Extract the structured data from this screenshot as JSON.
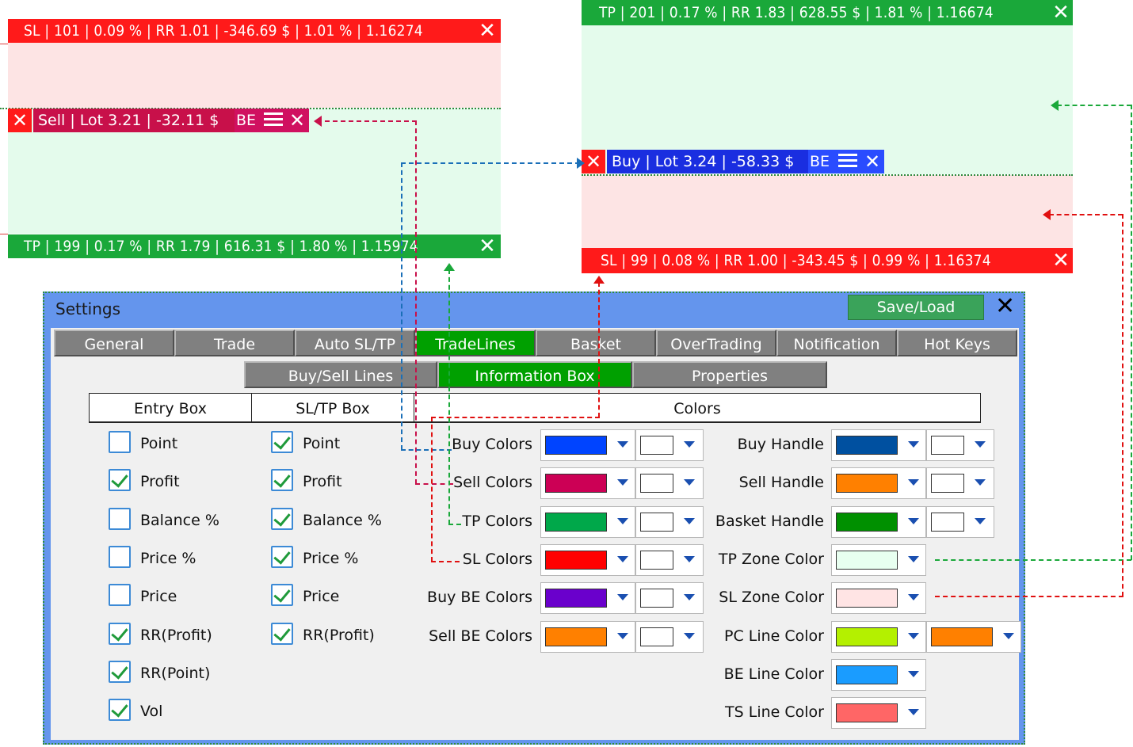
{
  "sell_box": {
    "sl_bar": "SL | 101 | 0.09 % | RR 1.01 | -346.69 $ | 1.01 % | 1.16274",
    "tp_bar": "TP | 199 | 0.17 % | RR 1.79 | 616.31 $ | 1.80 % | 1.15974",
    "label": "Sell | Lot 3.21 | -32.11 $",
    "be": "BE"
  },
  "buy_box": {
    "tp_bar": "TP | 201 | 0.17 % | RR 1.83 | 628.55 $ | 1.81 % | 1.16674",
    "sl_bar": "SL | 99 | 0.08 % | RR 1.00 | -343.45 $ | 0.99 % | 1.16374",
    "label": "Buy | Lot 3.24 | -58.33 $",
    "be": "BE"
  },
  "settings": {
    "title": "Settings",
    "save_load": "Save/Load",
    "close_glyph": "✕",
    "tabs": [
      "General",
      "Trade",
      "Auto SL/TP",
      "TradeLines",
      "Basket",
      "OverTrading",
      "Notification",
      "Hot Keys"
    ],
    "subtabs": [
      "Buy/Sell Lines",
      "Information Box",
      "Properties"
    ],
    "headers": {
      "entry": "Entry Box",
      "sltp": "SL/TP Box",
      "colors": "Colors"
    },
    "entry_box": [
      {
        "label": "Point",
        "checked": false
      },
      {
        "label": "Profit",
        "checked": true
      },
      {
        "label": "Balance %",
        "checked": false
      },
      {
        "label": "Price %",
        "checked": false
      },
      {
        "label": "Price",
        "checked": false
      },
      {
        "label": "RR(Profit)",
        "checked": true
      },
      {
        "label": "RR(Point)",
        "checked": true
      },
      {
        "label": "Vol",
        "checked": true
      }
    ],
    "sltp_box": [
      {
        "label": "Point",
        "checked": true
      },
      {
        "label": "Profit",
        "checked": true
      },
      {
        "label": "Balance %",
        "checked": true
      },
      {
        "label": "Price %",
        "checked": true
      },
      {
        "label": "Price",
        "checked": true
      },
      {
        "label": "RR(Profit)",
        "checked": true
      }
    ],
    "colors_left": [
      {
        "label": "Buy Colors",
        "c1": "#0044ff",
        "c2": "#ffffff"
      },
      {
        "label": "Sell Colors",
        "c1": "#cc0055",
        "c2": "#ffffff"
      },
      {
        "label": "TP Colors",
        "c1": "#00a84a",
        "c2": "#ffffff"
      },
      {
        "label": "SL Colors",
        "c1": "#ff0000",
        "c2": "#ffffff"
      },
      {
        "label": "Buy BE Colors",
        "c1": "#6a00cc",
        "c2": "#ffffff"
      },
      {
        "label": "Sell BE Colors",
        "c1": "#ff8000",
        "c2": "#ffffff"
      }
    ],
    "colors_right": [
      {
        "label": "Buy Handle",
        "c1": "#0050a0",
        "c2": "#ffffff"
      },
      {
        "label": "Sell Handle",
        "c1": "#ff8000",
        "c2": "#ffffff"
      },
      {
        "label": "Basket Handle",
        "c1": "#009000",
        "c2": "#ffffff"
      },
      {
        "label": "TP Zone Color",
        "c1": "#e8fff0",
        "c2": null
      },
      {
        "label": "SL Zone Color",
        "c1": "#ffe4e4",
        "c2": null
      },
      {
        "label": "PC Line Color",
        "c1": "#b4f000",
        "c2": "#ff8000"
      },
      {
        "label": "BE Line Color",
        "c1": "#1a9cff",
        "c2": null
      },
      {
        "label": "TS Line Color",
        "c1": "#ff6666",
        "c2": null
      }
    ]
  },
  "colors": {
    "sl_bar": "#ff1a1a",
    "tp_bar": "#1aa83a",
    "sell_label": "#c8104a",
    "sell_be": "#d01060",
    "buy_label": "#1a2ee0",
    "buy_be": "#2a4cff",
    "tp_zone": "#e4fbec",
    "sl_zone": "#fde4e4",
    "panel_bg": "#6495ed",
    "tab_active": "#00a000"
  }
}
